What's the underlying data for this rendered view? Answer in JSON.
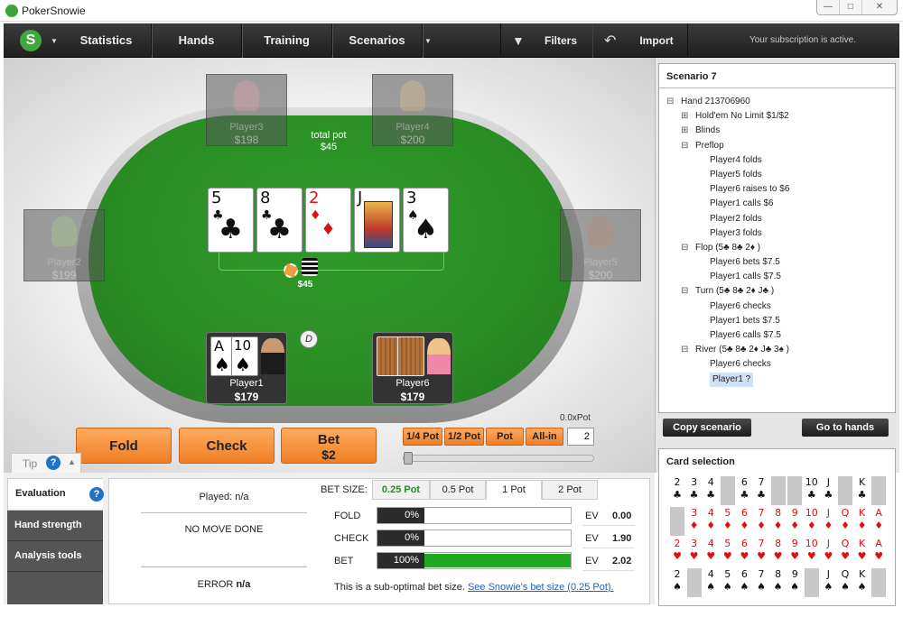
{
  "window": {
    "title": "PokerSnowie",
    "buttons": [
      "—",
      "□",
      "✕"
    ]
  },
  "nav": {
    "logo": "S",
    "items": [
      "Statistics",
      "Hands",
      "Training",
      "Scenarios",
      "Filters",
      "Import"
    ],
    "subscription": "Your subscription is active."
  },
  "table": {
    "total_pot_label": "total pot",
    "total_pot": "$45",
    "chip_pot": "$45",
    "dealer": "D",
    "seats": [
      {
        "name": "Player3",
        "stack": "$198"
      },
      {
        "name": "Player4",
        "stack": "$200"
      },
      {
        "name": "Player2",
        "stack": "$199"
      },
      {
        "name": "Player5",
        "stack": "$200"
      }
    ],
    "board": [
      {
        "rank": "5",
        "suit": "♣"
      },
      {
        "rank": "8",
        "suit": "♣"
      },
      {
        "rank": "2",
        "suit": "♦"
      },
      {
        "rank": "J",
        "suit": "♣"
      },
      {
        "rank": "3",
        "suit": "♠"
      }
    ],
    "hero": {
      "name": "Player1",
      "stack": "$179",
      "cards": [
        {
          "rank": "A",
          "suit": "♠"
        },
        {
          "rank": "10",
          "suit": "♠"
        }
      ]
    },
    "villain": {
      "name": "Player6",
      "stack": "$179"
    }
  },
  "actions": {
    "fold": "Fold",
    "check": "Check",
    "bet": "Bet",
    "bet_amount": "$2",
    "pot_buttons": [
      "1/4 Pot",
      "1/2 Pot",
      "Pot",
      "All-in"
    ],
    "pot_ratio": "0.0xPot",
    "bet_input": "2"
  },
  "tip": {
    "label": "Tip",
    "help": "?"
  },
  "sidebar": {
    "items": [
      "Evaluation",
      "Hand strength",
      "Analysis tools"
    ]
  },
  "evaluation": {
    "played": "Played: n/a",
    "no_move": "NO MOVE DONE",
    "error_label": "ERROR",
    "error_value": "n/a",
    "bet_size_label": "BET SIZE:",
    "bet_tabs": [
      "0.25 Pot",
      "0.5 Pot",
      "1 Pot",
      "2 Pot"
    ],
    "rows": [
      {
        "label": "FOLD",
        "pct": "0%",
        "fill": 0,
        "ev_label": "EV",
        "ev": "0.00"
      },
      {
        "label": "CHECK",
        "pct": "0%",
        "fill": 0,
        "ev_label": "EV",
        "ev": "1.90"
      },
      {
        "label": "BET",
        "pct": "100%",
        "fill": 1,
        "ev_label": "EV",
        "ev": "2.02"
      }
    ],
    "note": "This is a sub-optimal bet size.",
    "note_link": "See Snowie's bet size (0.25 Pot)."
  },
  "scenario": {
    "title": "Scenario 7",
    "tree": [
      {
        "t": "Hand 213706960",
        "lvl": 0,
        "exp": "⊟"
      },
      {
        "t": "Hold'em No Limit $1/$2",
        "lvl": 1,
        "exp": "⊞"
      },
      {
        "t": "Blinds",
        "lvl": 1,
        "exp": "⊞"
      },
      {
        "t": "Preflop",
        "lvl": 1,
        "exp": "⊟"
      },
      {
        "t": "Player4 folds",
        "lvl": 2
      },
      {
        "t": "Player5 folds",
        "lvl": 2
      },
      {
        "t": "Player6 raises to $6",
        "lvl": 2
      },
      {
        "t": "Player1 calls $6",
        "lvl": 2
      },
      {
        "t": "Player2 folds",
        "lvl": 2
      },
      {
        "t": "Player3 folds",
        "lvl": 2
      },
      {
        "t": "Flop (5♣ 8♣ 2♦ )",
        "lvl": 1,
        "exp": "⊟"
      },
      {
        "t": "Player6 bets $7.5",
        "lvl": 2
      },
      {
        "t": "Player1 calls $7.5",
        "lvl": 2
      },
      {
        "t": "Turn (5♣ 8♣ 2♦ J♣ )",
        "lvl": 1,
        "exp": "⊟"
      },
      {
        "t": "Player6 checks",
        "lvl": 2
      },
      {
        "t": "Player1 bets $7.5",
        "lvl": 2
      },
      {
        "t": "Player6 calls $7.5",
        "lvl": 2
      },
      {
        "t": "River (5♣ 8♣ 2♦ J♣ 3♠ )",
        "lvl": 1,
        "exp": "⊟"
      },
      {
        "t": "Player6 checks",
        "lvl": 2
      },
      {
        "t": "Player1 ?",
        "lvl": 2,
        "sel": true
      }
    ],
    "copy_button": "Copy scenario",
    "goto_button": "Go to hands"
  },
  "card_selection": {
    "title": "Card selection",
    "ranks": [
      "2",
      "3",
      "4",
      "5",
      "6",
      "7",
      "8",
      "9",
      "10",
      "J",
      "Q",
      "K",
      "A"
    ],
    "rows": [
      {
        "suit": "♣",
        "color": "#111",
        "used": [
          3,
          6,
          7,
          10,
          12
        ]
      },
      {
        "suit": "♦",
        "color": "#d11",
        "used": [
          0
        ]
      },
      {
        "suit": "♥",
        "color": "#d11",
        "used": []
      },
      {
        "suit": "♠",
        "color": "#111",
        "used": [
          1,
          8,
          12
        ]
      }
    ]
  }
}
